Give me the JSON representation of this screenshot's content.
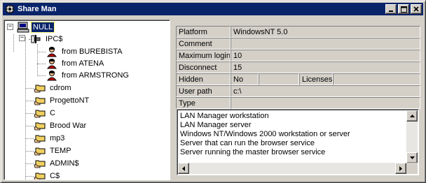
{
  "window": {
    "title": "Share Man",
    "icon": "share-man-app-icon"
  },
  "tree": {
    "root": {
      "label": "NULL",
      "icon": "computer-icon"
    },
    "ipc": {
      "label": "IPC$",
      "icon": "pipe-icon"
    },
    "sessions": [
      {
        "label": "from BUREBISTA",
        "icon": "user-icon"
      },
      {
        "label": "from ATENA",
        "icon": "user-icon"
      },
      {
        "label": "from ARMSTRONG",
        "icon": "user-icon"
      }
    ],
    "shares": [
      {
        "label": "cdrom",
        "icon": "shared-folder-icon"
      },
      {
        "label": "ProgettoNT",
        "icon": "shared-folder-icon"
      },
      {
        "label": "C",
        "icon": "shared-folder-icon"
      },
      {
        "label": "Brood War",
        "icon": "shared-folder-icon"
      },
      {
        "label": "mp3",
        "icon": "shared-folder-icon"
      },
      {
        "label": "TEMP",
        "icon": "shared-folder-icon"
      },
      {
        "label": "ADMIN$",
        "icon": "shared-folder-icon"
      },
      {
        "label": "C$",
        "icon": "shared-folder-icon"
      }
    ]
  },
  "properties": {
    "platform": {
      "label": "Platform",
      "value": "WindowsNT 5.0"
    },
    "comment": {
      "label": "Comment",
      "value": ""
    },
    "max_logins": {
      "label": "Maximum logins",
      "value": "10"
    },
    "disconnect": {
      "label": "Disconnect",
      "value": "15"
    },
    "hidden": {
      "label": "Hidden",
      "value": "No",
      "licenses_label": "Licenses",
      "licenses_value": ""
    },
    "user_path": {
      "label": "User path",
      "value": "c:\\"
    },
    "type": {
      "label": "Type",
      "value": ""
    }
  },
  "type_list": [
    "LAN Manager workstation",
    "LAN Manager server",
    "Windows NT/Windows 2000 workstation or server",
    "Server that can run the browser service",
    "Server running the master browser service"
  ],
  "colors": {
    "titlebar": "#0a246a",
    "face": "#d4d0c8",
    "selection": "#0a246a"
  }
}
